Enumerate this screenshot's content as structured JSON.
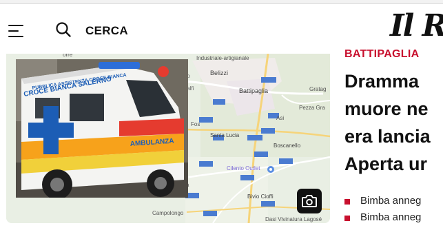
{
  "header": {
    "search_label": "CERCA",
    "logo_text": "Il R"
  },
  "hero": {
    "map_labels": {
      "industrial": "Industriale-artigianale",
      "porto": "orto",
      "amalfi": "-malfi",
      "belizzi": "Belizzi",
      "battipaglia": "Battipaglia",
      "gratag": "Gratag",
      "pezza_gra": "Pezza Gra",
      "asi": "Asi",
      "fos": "Fos",
      "santa_lucia": "Santa Lucia",
      "boscanello": "Boscanello",
      "cilento_outlet": "Cilento Outlet",
      "ana": "ana",
      "bivio_cioffi": "Bivio Cioffi",
      "campolongo": "Campolongo",
      "dasi": "Dasi Vivinatura Lagosé",
      "orre": "orre"
    },
    "ambulance_text": {
      "roof": "PUBBLICA ASSISTENZA CROCE BIANCA",
      "side": "CROCE BIANCA SALERNO",
      "front": "AMBULANZA"
    },
    "camera_icon": "camera-icon"
  },
  "article": {
    "kicker": "BATTIPAGLIA",
    "headline_lines": [
      "Dramma",
      "muore ne",
      "era lancia",
      "Aperta ur"
    ],
    "related": [
      "Bimba anneg",
      "Bimba anneg"
    ]
  },
  "colors": {
    "accent": "#c8102e",
    "text": "#111111",
    "map_bg": "#e8eee3"
  }
}
